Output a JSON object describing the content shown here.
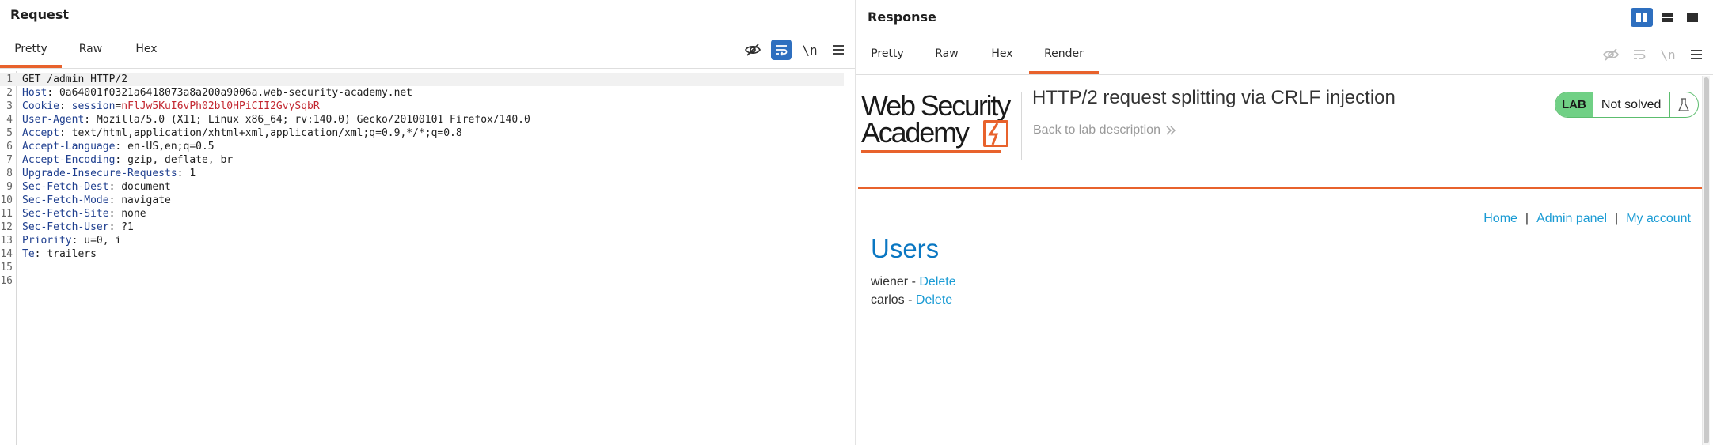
{
  "request": {
    "title": "Request",
    "tabs": [
      {
        "label": "Pretty",
        "active": true
      },
      {
        "label": "Raw",
        "active": false
      },
      {
        "label": "Hex",
        "active": false
      }
    ],
    "toolbar": {
      "newline_label": "\\n"
    },
    "lines": [
      {
        "n": "1",
        "text": "GET /admin HTTP/2"
      },
      {
        "n": "2",
        "key": "Host",
        "value": "0a64001f0321a6418073a8a200a9006a.web-security-academy.net"
      },
      {
        "n": "3",
        "key": "Cookie",
        "cookie_name": "session",
        "cookie_value": "nFlJw5KuI6vPh02bl0HPiCII2GvySqbR"
      },
      {
        "n": "4",
        "key": "User-Agent",
        "value": "Mozilla/5.0 (X11; Linux x86_64; rv:140.0) Gecko/20100101 Firefox/140.0"
      },
      {
        "n": "5",
        "key": "Accept",
        "value": "text/html,application/xhtml+xml,application/xml;q=0.9,*/*;q=0.8"
      },
      {
        "n": "6",
        "key": "Accept-Language",
        "value": "en-US,en;q=0.5"
      },
      {
        "n": "7",
        "key": "Accept-Encoding",
        "value": "gzip, deflate, br"
      },
      {
        "n": "8",
        "key": "Upgrade-Insecure-Requests",
        "value": "1"
      },
      {
        "n": "9",
        "key": "Sec-Fetch-Dest",
        "value": "document"
      },
      {
        "n": "10",
        "key": "Sec-Fetch-Mode",
        "value": "navigate"
      },
      {
        "n": "11",
        "key": "Sec-Fetch-Site",
        "value": "none"
      },
      {
        "n": "12",
        "key": "Sec-Fetch-User",
        "value": "?1"
      },
      {
        "n": "13",
        "key": "Priority",
        "value": "u=0, i"
      },
      {
        "n": "14",
        "key": "Te",
        "value": "trailers"
      },
      {
        "n": "15"
      },
      {
        "n": "16"
      }
    ]
  },
  "response": {
    "title": "Response",
    "tabs": [
      {
        "label": "Pretty",
        "active": false
      },
      {
        "label": "Raw",
        "active": false
      },
      {
        "label": "Hex",
        "active": false
      },
      {
        "label": "Render",
        "active": true
      }
    ],
    "toolbar": {
      "newline_label": "\\n"
    },
    "render": {
      "logo_line1": "Web Security",
      "logo_line2": "Academy",
      "lab_title": "HTTP/2 request splitting via CRLF injection",
      "back_link": "Back to lab description",
      "badge_lab": "LAB",
      "badge_status": "Not solved",
      "nav": {
        "home": "Home",
        "separator": "|",
        "admin": "Admin panel",
        "account": "My account"
      },
      "heading": "Users",
      "users": [
        {
          "name": "wiener",
          "dash": " - ",
          "action": "Delete"
        },
        {
          "name": "carlos",
          "dash": " - ",
          "action": "Delete"
        }
      ]
    }
  },
  "colors": {
    "accent_orange": "#e8622c",
    "toolbar_active": "#2e6fbf",
    "header_key": "#1f3f8f",
    "cookie_value": "#c2262f",
    "link_blue": "#1a9bd4",
    "heading_blue": "#0a77c2",
    "badge_green": "#70d085"
  },
  "icons": [
    "eye-slash-icon",
    "wrap-lines-icon",
    "newline-icon",
    "hamburger-menu-icon",
    "split-horizontal-icon",
    "split-vertical-icon",
    "single-pane-icon",
    "chevron-double-right-icon",
    "flask-icon"
  ]
}
